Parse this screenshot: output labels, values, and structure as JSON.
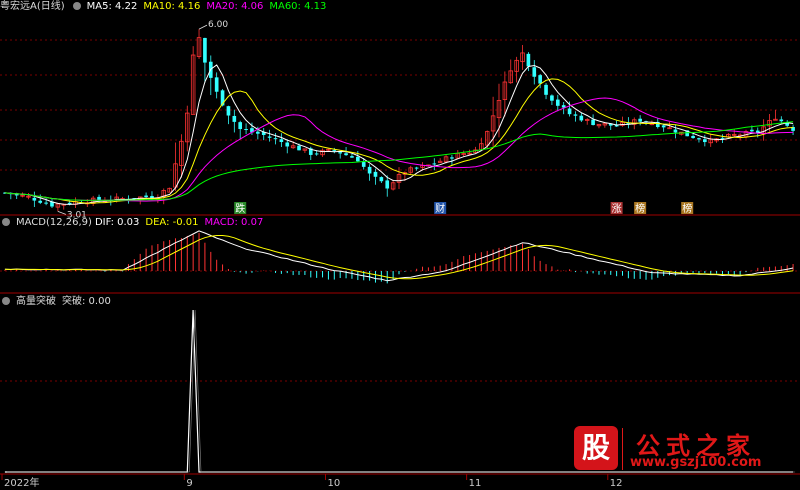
{
  "header": {
    "stock_title": "粤宏远A(日线)",
    "ma": [
      {
        "label": "MA5: 4.22",
        "color": "#ffffff"
      },
      {
        "label": "MA10: 4.16",
        "color": "#ffff00"
      },
      {
        "label": "MA20: 4.06",
        "color": "#ff00ff"
      },
      {
        "label": "MA60: 4.13",
        "color": "#00ff00"
      }
    ]
  },
  "macd_header": {
    "title": "MACD(12,26,9)",
    "dif": "DIF: 0.03",
    "dea": "DEA: -0.01",
    "macd": "MACD: 0.07"
  },
  "indicator_header": {
    "title": "高量突破",
    "value": "突破: 0.00"
  },
  "annotations": {
    "high": "6.00",
    "low": "3.01",
    "markers": [
      {
        "text": "跌",
        "bg": "#2a8a2a"
      },
      {
        "text": "财",
        "bg": "#2255aa"
      },
      {
        "text": "涨",
        "bg": "#aa3333"
      },
      {
        "text": "榜",
        "bg": "#aa7722"
      },
      {
        "text": "榜",
        "bg": "#aa7722"
      }
    ]
  },
  "x_axis": {
    "labels": [
      "2022年",
      "9",
      "10",
      "11",
      "12"
    ]
  },
  "watermark": {
    "logo": "股",
    "title": "公式之家",
    "url": "www.gszj100.com"
  },
  "colors": {
    "up": "#ff3333",
    "down": "#33ffff",
    "grid": "#7a0000",
    "axis": "#a00000"
  },
  "chart_data": {
    "type": "candlestick",
    "n_bars": 135,
    "price_range": [
      2.9,
      6.2
    ],
    "anchors": [
      [
        0,
        3.25
      ],
      [
        4,
        3.18
      ],
      [
        8,
        3.05
      ],
      [
        14,
        3.12
      ],
      [
        20,
        3.15
      ],
      [
        26,
        3.2
      ],
      [
        28,
        3.35
      ],
      [
        30,
        4.1
      ],
      [
        31,
        4.6
      ],
      [
        32,
        5.5
      ],
      [
        33,
        5.8
      ],
      [
        34,
        5.4
      ],
      [
        36,
        4.9
      ],
      [
        38,
        4.55
      ],
      [
        40,
        4.3
      ],
      [
        44,
        4.2
      ],
      [
        48,
        4.05
      ],
      [
        52,
        3.9
      ],
      [
        56,
        3.95
      ],
      [
        60,
        3.8
      ],
      [
        62,
        3.55
      ],
      [
        65,
        3.35
      ],
      [
        68,
        3.6
      ],
      [
        72,
        3.7
      ],
      [
        76,
        3.85
      ],
      [
        80,
        3.95
      ],
      [
        82,
        4.25
      ],
      [
        84,
        4.8
      ],
      [
        86,
        5.3
      ],
      [
        88,
        5.55
      ],
      [
        90,
        5.2
      ],
      [
        92,
        4.9
      ],
      [
        94,
        4.7
      ],
      [
        96,
        4.55
      ],
      [
        100,
        4.4
      ],
      [
        104,
        4.35
      ],
      [
        108,
        4.45
      ],
      [
        112,
        4.35
      ],
      [
        116,
        4.2
      ],
      [
        120,
        4.1
      ],
      [
        124,
        4.2
      ],
      [
        128,
        4.25
      ],
      [
        131,
        4.5
      ],
      [
        134,
        4.3
      ]
    ],
    "macd_series": {
      "dif_peaks": [
        [
          0,
          0.02
        ],
        [
          20,
          0.01
        ],
        [
          33,
          0.42
        ],
        [
          40,
          0.25
        ],
        [
          55,
          0.02
        ],
        [
          65,
          -0.1
        ],
        [
          75,
          0.0
        ],
        [
          88,
          0.3
        ],
        [
          95,
          0.2
        ],
        [
          110,
          -0.02
        ],
        [
          125,
          -0.05
        ],
        [
          134,
          0.03
        ]
      ]
    },
    "breakout": {
      "series": [
        {
          "name": "突破",
          "x": [
            0,
            31,
            32,
            33,
            134
          ],
          "values": [
            0,
            0,
            1,
            0,
            0
          ]
        }
      ]
    }
  }
}
